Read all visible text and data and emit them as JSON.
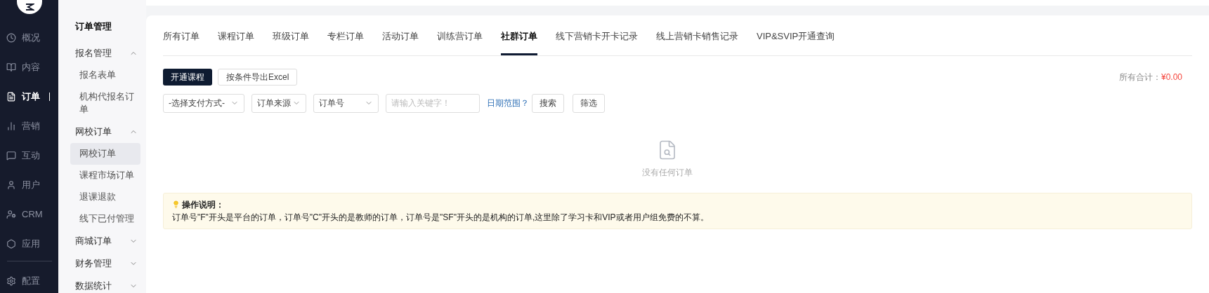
{
  "nav": {
    "items": [
      {
        "label": "概况",
        "selected": false
      },
      {
        "label": "内容",
        "selected": false
      },
      {
        "label": "订单",
        "selected": true
      },
      {
        "label": "营销",
        "selected": false
      },
      {
        "label": "互动",
        "selected": false
      },
      {
        "label": "用户",
        "selected": false
      },
      {
        "label": "CRM",
        "selected": false
      },
      {
        "label": "应用",
        "selected": false
      }
    ],
    "footer_item": {
      "label": "配置",
      "selected": false
    }
  },
  "sidebar": {
    "title": "订单管理",
    "groups": [
      {
        "label": "报名管理",
        "expanded": true,
        "children": [
          {
            "label": "报名表单",
            "selected": false
          },
          {
            "label": "机构代报名订单",
            "selected": false
          }
        ]
      },
      {
        "label": "网校订单",
        "expanded": true,
        "children": [
          {
            "label": "网校订单",
            "selected": true
          },
          {
            "label": "课程市场订单",
            "selected": false
          },
          {
            "label": "退课退款",
            "selected": false
          },
          {
            "label": "线下已付管理",
            "selected": false
          }
        ]
      },
      {
        "label": "商城订单",
        "expanded": false
      },
      {
        "label": "财务管理",
        "expanded": false
      },
      {
        "label": "数据统计",
        "expanded": false
      }
    ]
  },
  "tabs": [
    {
      "label": "所有订单",
      "selected": false
    },
    {
      "label": "课程订单",
      "selected": false
    },
    {
      "label": "班级订单",
      "selected": false
    },
    {
      "label": "专栏订单",
      "selected": false
    },
    {
      "label": "活动订单",
      "selected": false
    },
    {
      "label": "训练营订单",
      "selected": false
    },
    {
      "label": "社群订单",
      "selected": true
    },
    {
      "label": "线下营销卡开卡记录",
      "selected": false
    },
    {
      "label": "线上营销卡销售记录",
      "selected": false
    },
    {
      "label": "VIP&SVIP开通查询",
      "selected": false
    }
  ],
  "actions": [
    {
      "label": "开通课程",
      "kind": "primary"
    },
    {
      "label": "按条件导出Excel",
      "kind": "default"
    }
  ],
  "total": {
    "label": "所有合计：",
    "value": "¥0.00"
  },
  "filters": {
    "selects": [
      "-选择支付方式-",
      "订单来源",
      "订单号"
    ],
    "keyword": {
      "placeholder": "请输入关键字！"
    },
    "date_link": "日期范围？",
    "buttons": [
      "搜索",
      "筛选"
    ]
  },
  "empty": {
    "text": "没有任何订单"
  },
  "note": {
    "title": "操作说明：",
    "text": "订单号\"F\"开头是平台的订单，订单号\"C\"开头的是教师的订单，订单号是\"SF\"开头的是机构的订单,这里除了学习卡和VIP或者用户组免费的不算。"
  }
}
